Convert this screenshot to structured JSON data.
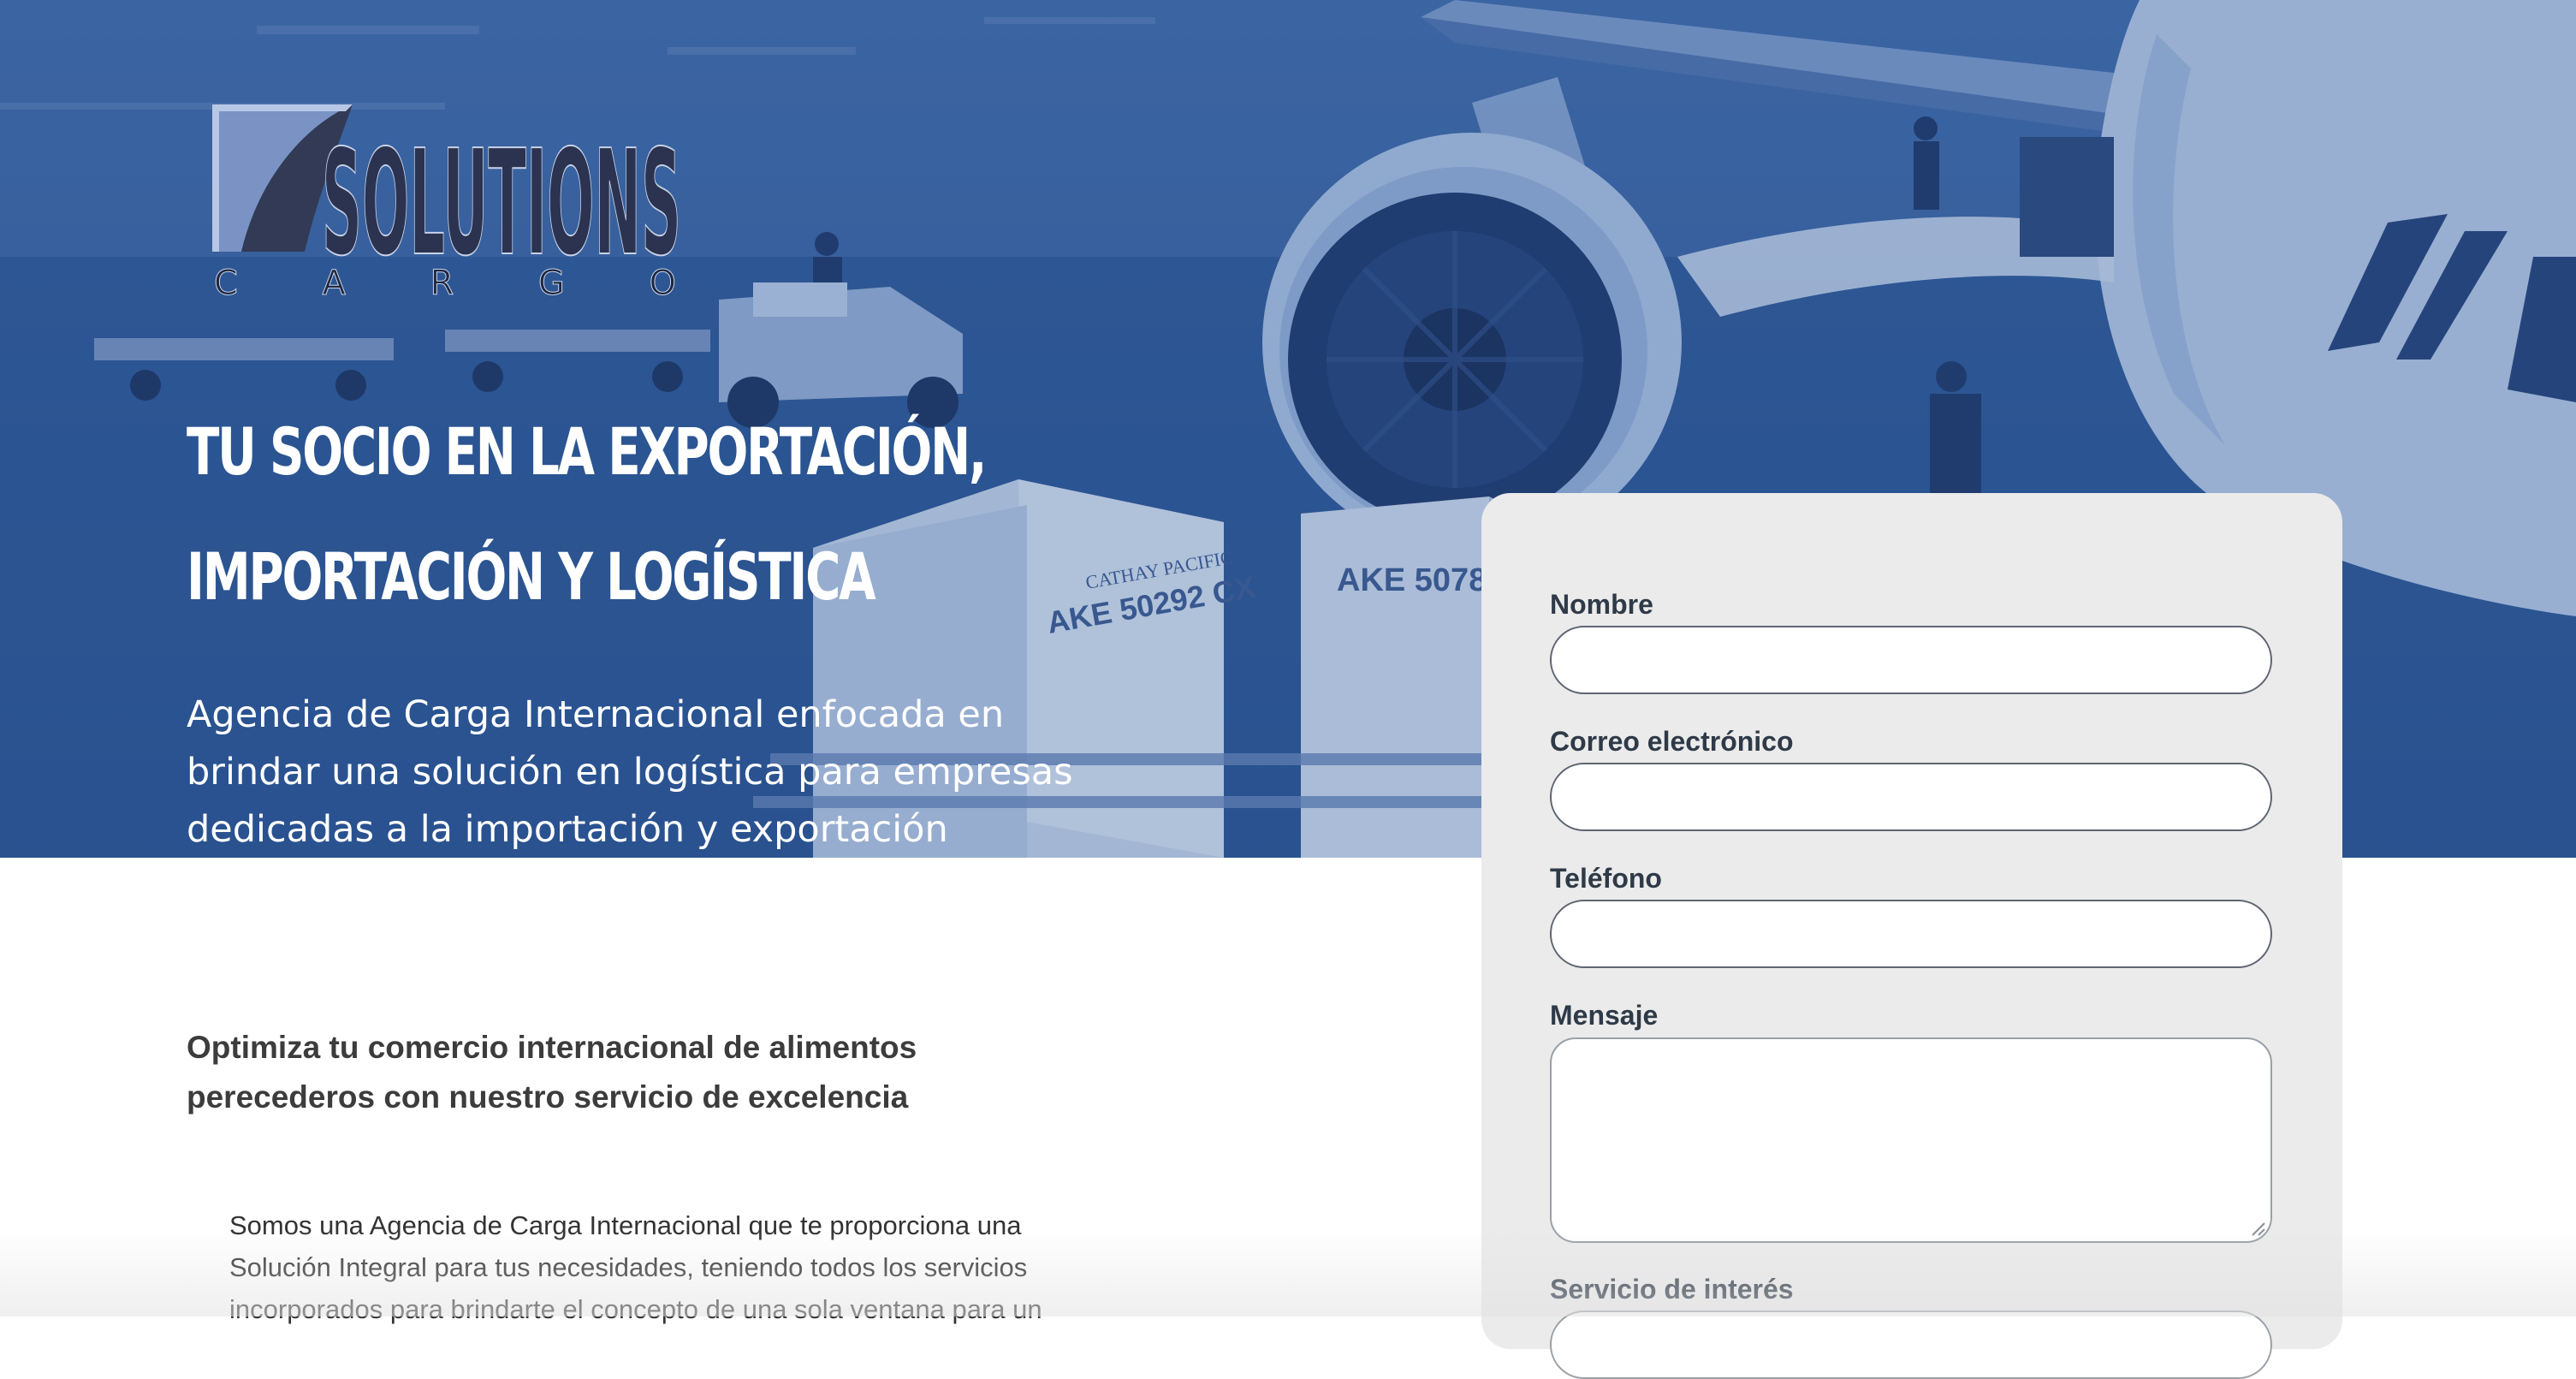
{
  "brand": {
    "logo_word": "SOLUTIONS",
    "logo_sub": "C A R G O"
  },
  "hero": {
    "title_line1": "TU SOCIO EN LA EXPORTACIÓN,",
    "title_line2": "IMPORTACIÓN Y LOGÍSTICA",
    "subtitle_line1": "Agencia de Carga Internacional enfocada en",
    "subtitle_line2": "brindar una solución en logística para empresas",
    "subtitle_line3": "dedicadas a la importación y exportación",
    "cargo_label_1": "AKE 50292 CX",
    "cargo_label_2": "AKE 5078",
    "cargo_brand": "CATHAY PACIFIC"
  },
  "content": {
    "heading_line1": "Optimiza tu comercio internacional de alimentos",
    "heading_line2": "perecederos con nuestro servicio de excelencia",
    "body_line1": "Somos una Agencia de Carga Internacional que te proporciona una",
    "body_line2": "Solución Integral para tus necesidades, teniendo todos los servicios",
    "body_line3": "incorporados para brindarte el concepto de una sola ventana para un"
  },
  "form": {
    "name_label": "Nombre",
    "email_label": "Correo electrónico",
    "phone_label": "Teléfono",
    "message_label": "Mensaje",
    "service_label": "Servicio de interés",
    "name_value": "",
    "email_value": "",
    "phone_value": "",
    "message_value": ""
  },
  "colors": {
    "hero_tint": "#2f5894",
    "form_background": "#ebebeb",
    "label_text": "#2f3a48",
    "heading_text": "#3c3c3c"
  }
}
